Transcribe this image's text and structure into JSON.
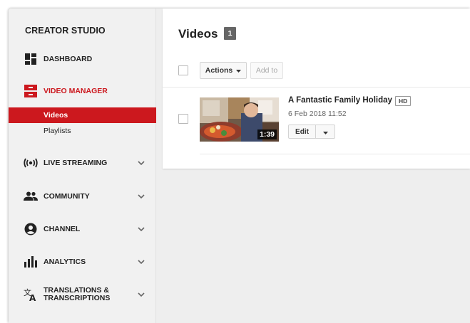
{
  "sidebar": {
    "title": "CREATOR STUDIO",
    "items": [
      {
        "label": "DASHBOARD",
        "icon": "dashboard-icon"
      },
      {
        "label": "VIDEO MANAGER",
        "icon": "video-manager-icon"
      },
      {
        "label": "LIVE STREAMING",
        "icon": "live-streaming-icon"
      },
      {
        "label": "COMMUNITY",
        "icon": "community-icon"
      },
      {
        "label": "CHANNEL",
        "icon": "channel-icon"
      },
      {
        "label": "ANALYTICS",
        "icon": "analytics-icon"
      },
      {
        "label": "TRANSLATIONS &\nTRANSCRIPTIONS",
        "icon": "translate-icon"
      }
    ],
    "subitems": [
      {
        "label": "Videos",
        "active": true
      },
      {
        "label": "Playlists",
        "active": false
      }
    ]
  },
  "main": {
    "title": "Videos",
    "count": "1",
    "toolbar": {
      "actions_label": "Actions",
      "addto_label": "Add to"
    },
    "videos": [
      {
        "title": "A Fantastic Family Holiday",
        "quality": "HD",
        "date": "6 Feb 2018 11:52",
        "duration": "1:39",
        "edit_label": "Edit"
      }
    ]
  },
  "colors": {
    "accent": "#cc181e",
    "sidebar_bg": "#f1f1f1",
    "page_bg": "#eeeeee"
  }
}
